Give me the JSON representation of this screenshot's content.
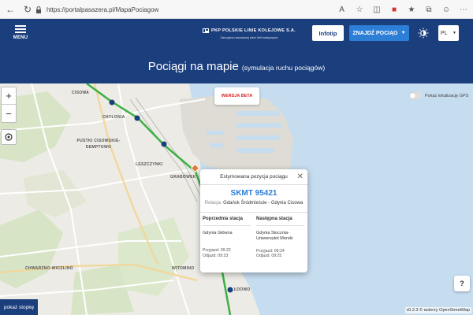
{
  "browser": {
    "url": "https://portalpasazera.pl/MapaPociagow"
  },
  "header": {
    "menu_label": "MENU",
    "brand_name": "PKP POLSKIE LINIE KOLEJOWE S.A.",
    "brand_sub": "Zarządca narodowej sieci linii kolejowych",
    "infotip_label": "Infotip",
    "find_train_label": "ZNAJDŹ POCIĄG",
    "language": "PL",
    "accent_color": "#1b3e7d",
    "button_color": "#2c7ed6"
  },
  "page": {
    "title": "Pociągi na mapie",
    "title_note": "(symulacja ruchu pociągów)"
  },
  "map": {
    "beta_label": "WERSJA BETA",
    "gps_label": "Pokaż lokalizację GPS",
    "help_label": "?",
    "attribution": "v0.2.3 © autorzy OpenStreetMap",
    "places": [
      "CISOWA",
      "CHYLONIA",
      "PUSTKI CISOWSKIE-DEMPTOWO",
      "LESZCZYNKI",
      "GRABÓWEK",
      "CHWARZNO-WICZLINO",
      "WITOMINO",
      "ŁDOWO"
    ],
    "route_color": "#3cb043",
    "stop_color": "#1b3e7d"
  },
  "popup": {
    "header": "Estymowana pozycja pociągu",
    "train_number": "SKMT 95421",
    "relation_label": "Relacja:",
    "relation_value": "Gdańsk Śródmieście - Gdynia Cisowa",
    "prev_header": "Poprzednia stacja",
    "prev_station": "Gdynia Główna",
    "prev_arrival": "Przyjazd: 09:22",
    "prev_departure": "Odjazd: 09:23",
    "next_header": "Następna stacja",
    "next_station": "Gdynia Stocznia-Uniwersytet Morski",
    "next_arrival": "Przyjazd: 09:24",
    "next_departure": "Odjazd: 09:25"
  },
  "footer": {
    "link_label": "pokaż stopkę"
  }
}
